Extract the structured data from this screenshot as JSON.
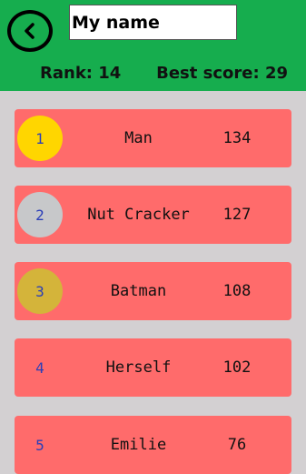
{
  "header": {
    "back_icon": "chevron-left-icon",
    "name_input_value": "My name",
    "rank_text": "Rank: 14",
    "best_score_text": "Best score: 29",
    "background_color": "#16ad4e"
  },
  "leaderboard": {
    "row_color": "#ff6b6b",
    "rows": [
      {
        "rank": "1",
        "name": "Man",
        "score": "134",
        "medal": "gold",
        "medal_color": "#ffd600"
      },
      {
        "rank": "2",
        "name": "Nut Cracker",
        "score": "127",
        "medal": "silver",
        "medal_color": "#c7c8ca"
      },
      {
        "rank": "3",
        "name": "Batman",
        "score": "108",
        "medal": "bronze",
        "medal_color": "#d4b43a"
      },
      {
        "rank": "4",
        "name": "Herself",
        "score": "102",
        "medal": "none",
        "medal_color": ""
      },
      {
        "rank": "5",
        "name": "Emilie",
        "score": "76",
        "medal": "none",
        "medal_color": ""
      }
    ]
  }
}
